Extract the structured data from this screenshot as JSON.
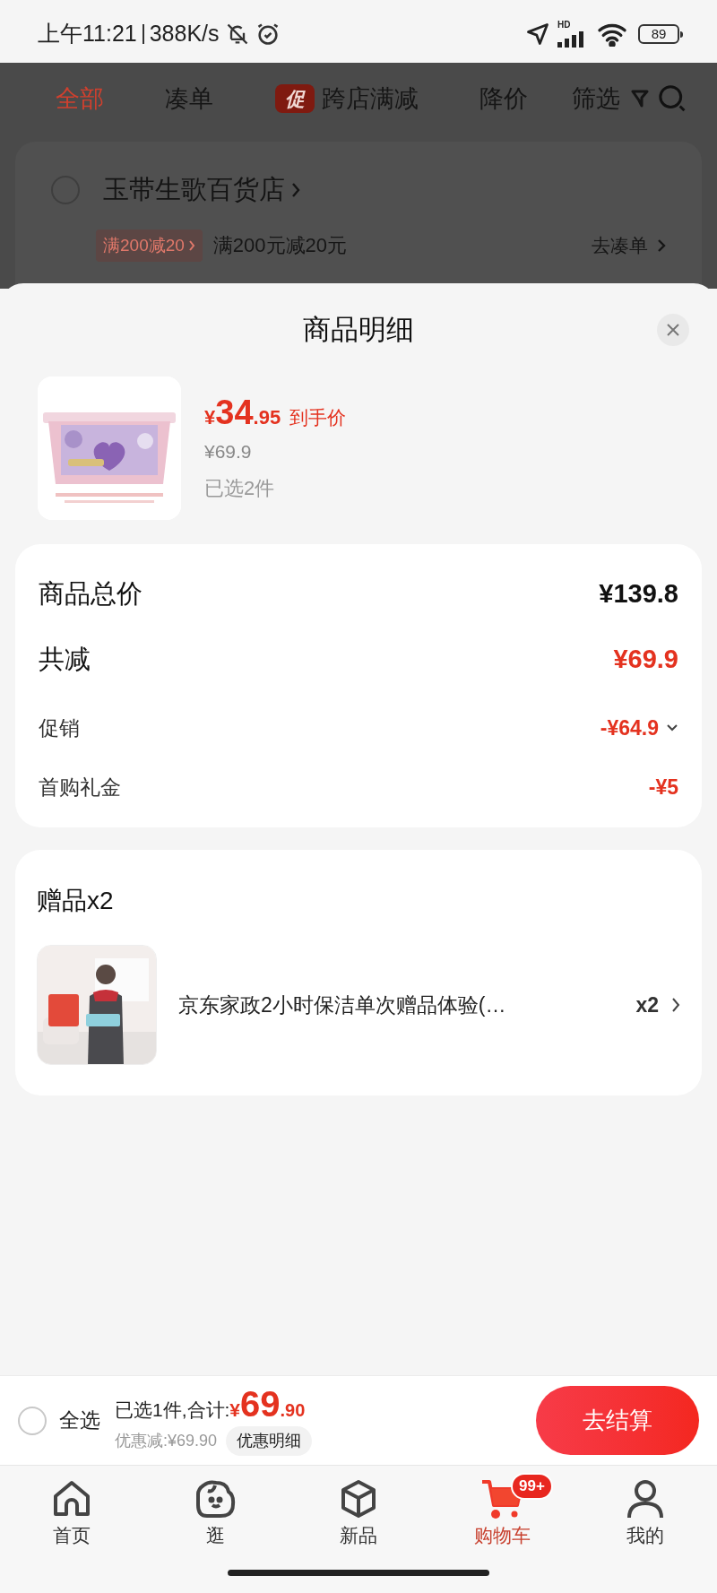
{
  "status_bar": {
    "time": "上午11:21",
    "speed": "388K/s",
    "network": "HD",
    "battery": "89"
  },
  "tabs": [
    {
      "label": "全部",
      "kind": "tab",
      "selected": true
    },
    {
      "label": "凑单",
      "kind": "tab",
      "selected": false
    },
    {
      "label": "跨店满减",
      "kind": "promo",
      "badge": "促",
      "selected": false
    },
    {
      "label": "降价",
      "kind": "tab",
      "selected": false
    },
    {
      "label": "筛选",
      "kind": "filter",
      "selected": false
    }
  ],
  "store": {
    "name": "玉带生歌百货店",
    "checked": false,
    "promo_tag": "满200减20",
    "promo_text": "满200元减20元",
    "link": "去凑单"
  },
  "sheet": {
    "title": "商品明细",
    "product": {
      "price_symbol": "¥",
      "price_int": "34",
      "price_dec": ".95",
      "price_label": "到手价",
      "original_price": "¥69.9",
      "quantity": "已选2件"
    },
    "summary": [
      {
        "label": "商品总价",
        "value": "¥139.8",
        "kind": "total",
        "expandable": false
      },
      {
        "label": "共减",
        "value": "¥69.9",
        "kind": "discount",
        "expandable": false
      },
      {
        "label": "促销",
        "value": "-¥64.9",
        "kind": "detail",
        "expandable": true
      },
      {
        "label": "首购礼金",
        "value": "-¥5",
        "kind": "detail",
        "expandable": false
      }
    ],
    "gifts": {
      "title": "赠品x2",
      "items": [
        {
          "name": "京东家政2小时保洁单次赠品体验(…",
          "quantity": "x2"
        }
      ]
    }
  },
  "footer": {
    "select_all": {
      "label": "全选",
      "checked": false
    },
    "summary": "已选1件,合计:",
    "total_symbol": "¥",
    "total_int": "69",
    "total_dec": ".90",
    "saving": "优惠减:¥69.90",
    "detail_button": "优惠明细",
    "checkout": "去结算"
  },
  "nav": [
    {
      "label": "首页",
      "kind": "home",
      "selected": false
    },
    {
      "label": "逛",
      "kind": "explore",
      "selected": false
    },
    {
      "label": "新品",
      "kind": "new",
      "selected": false
    },
    {
      "label": "购物车",
      "kind": "cart",
      "selected": true,
      "badge": "99+"
    },
    {
      "label": "我的",
      "kind": "profile",
      "selected": false
    }
  ]
}
